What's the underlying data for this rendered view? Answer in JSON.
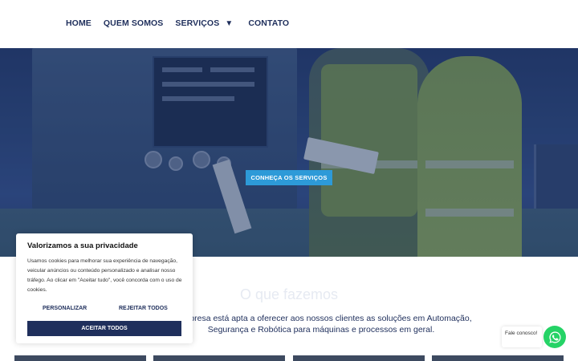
{
  "nav": {
    "items": [
      "HOME",
      "QUEM SOMOS",
      "SERVIÇOS",
      "CONTATO"
    ],
    "dropdown_caret": "▼"
  },
  "hero": {
    "cta_label": "CONHEÇA OS SERVIÇOS"
  },
  "section": {
    "title": "O que fazemos",
    "description": "A empresa está apta a oferecer aos nossos clientes as soluções em Automação, Segurança e Robótica para máquinas e processos em geral."
  },
  "cookie": {
    "title": "Valorizamos a sua privacidade",
    "text": "Usamos cookies para melhorar sua experiência de navegação, veicular anúncios ou conteúdo personalizado e analisar nosso tráfego. Ao clicar em \"Aceitar tudo\", você concorda com o uso de cookies.",
    "customize_label": "PERSONALIZAR",
    "reject_label": "REJEITAR TODOS",
    "accept_label": "ACEITAR TODOS"
  },
  "whatsapp": {
    "bubble_text": "Fale conosco!",
    "icon": "whatsapp-icon"
  },
  "colors": {
    "brand_navy": "#1f2f5c",
    "accent_blue": "#2d9ad8",
    "whatsapp_green": "#25d366"
  }
}
